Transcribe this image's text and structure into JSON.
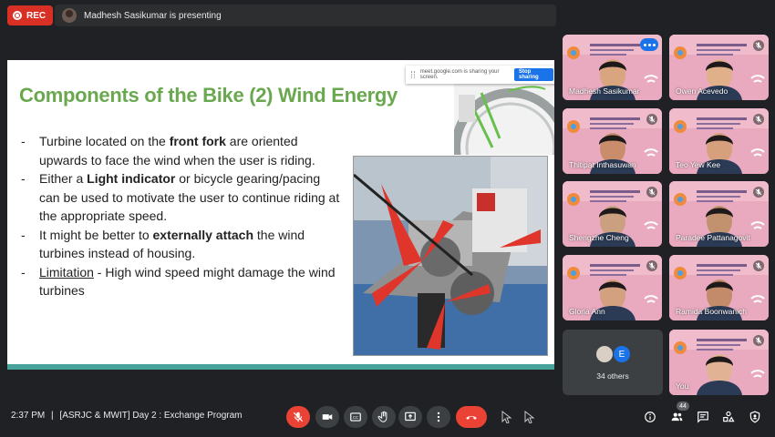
{
  "recording": {
    "label": "REC",
    "color": "#d93025"
  },
  "presenter_bar": {
    "text": "Madhesh Sasikumar is presenting"
  },
  "slide": {
    "title": "Components of the Bike (2) Wind Energy",
    "title_color": "#6aa84f",
    "accent_color": "#47a39a",
    "bullets": [
      {
        "parts": [
          {
            "t": "Turbine located on the "
          },
          {
            "t": "front fork",
            "b": true
          },
          {
            "t": " are oriented upwards to face the wind when the user is riding."
          }
        ]
      },
      {
        "parts": [
          {
            "t": "Either a "
          },
          {
            "t": "Light indicator",
            "b": true
          },
          {
            "t": " or bicycle gearing/pacing can be used to motivate the user to continue riding at the appropriate speed."
          }
        ]
      },
      {
        "parts": [
          {
            "t": "It might be better to "
          },
          {
            "t": "externally attach",
            "b": true
          },
          {
            "t": " the wind turbines instead of housing."
          }
        ]
      },
      {
        "parts": [
          {
            "t": "Limitation",
            "u": true
          },
          {
            "t": " - High wind speed might damage the wind turbines"
          }
        ]
      }
    ],
    "share_notice": "meet.google.com is sharing your screen.",
    "stop_sharing": "Stop sharing"
  },
  "participants": [
    {
      "name": "Madhesh Sasikumar",
      "speaking": true
    },
    {
      "name": "Owen Acevedo"
    },
    {
      "name": "Thitipat Inthasuwan"
    },
    {
      "name": "Teo Yew Kee"
    },
    {
      "name": "Shengzhe Cheng"
    },
    {
      "name": "Paradee Pattanagovit"
    },
    {
      "name": "Gloria Ann"
    },
    {
      "name": "Ramida Boonwanich"
    },
    {
      "name": "You"
    }
  ],
  "others": {
    "label": "34 others",
    "initial": "E"
  },
  "bottom": {
    "time": "2:37 PM",
    "separator": "|",
    "meeting": "[ASRJC & MWIT] Day 2 : Exchange Program",
    "people_count": "44"
  },
  "icons": {
    "mic": "mic-off-icon",
    "camera": "camera-icon",
    "captions": "captions-icon",
    "hand": "raise-hand-icon",
    "present": "present-icon",
    "more": "more-vert-icon",
    "hangup": "hang-up-icon",
    "info": "info-icon",
    "people": "people-icon",
    "chat": "chat-icon",
    "activities": "activities-icon",
    "host": "host-controls-icon"
  },
  "colors": {
    "danger": "#ea4335",
    "primary": "#1a73e8",
    "surface": "#202124",
    "control": "#3c4043"
  }
}
